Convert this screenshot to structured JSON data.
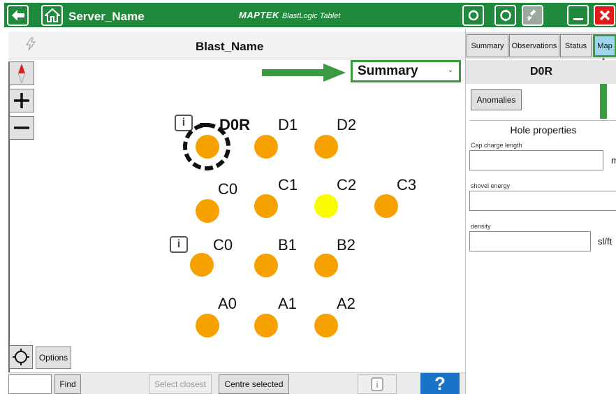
{
  "titlebar": {
    "server_name": "Server_Name",
    "brand_main": "MAPTEK",
    "brand_sub": "BlastLogic Tablet"
  },
  "header": {
    "blast_name": "Blast_Name"
  },
  "summary_dropdown": {
    "selected": "Summary"
  },
  "holes": [
    {
      "label": "D0R",
      "highlight": false,
      "selected": true
    },
    {
      "label": "D1",
      "highlight": false
    },
    {
      "label": "D2",
      "highlight": false
    },
    {
      "label": "C0",
      "highlight": false
    },
    {
      "label": "C1",
      "highlight": false
    },
    {
      "label": "C2",
      "highlight": true
    },
    {
      "label": "C3",
      "highlight": false
    },
    {
      "label": "C0",
      "highlight": false
    },
    {
      "label": "B1",
      "highlight": false
    },
    {
      "label": "B2",
      "highlight": false
    },
    {
      "label": "A0",
      "highlight": false
    },
    {
      "label": "A1",
      "highlight": false
    },
    {
      "label": "A2",
      "highlight": false
    }
  ],
  "bottom_bar": {
    "find_label": "Find",
    "select_closest_label": "Select closest",
    "centre_selected_label": "Centre selected",
    "help_label": "?",
    "options_label": "Options"
  },
  "right_panel": {
    "tabs": [
      "Summary",
      "Observations",
      "Status",
      "Map"
    ],
    "active_tab": "Map",
    "hole_title": "D0R",
    "anomalies_label": "Anomalies",
    "section_title": "Hole properties",
    "fields": [
      {
        "label": "Cap charge length",
        "unit": "m"
      },
      {
        "label": "shovel energy",
        "unit": ""
      },
      {
        "label": "density",
        "unit": "sl/ft"
      }
    ]
  },
  "colors": {
    "brand_green": "#1f8a3b",
    "hole_orange": "#f7a100",
    "hole_yellow": "#fbfb00",
    "accent_green": "#3a9a3f",
    "help_blue": "#1973c7",
    "active_tab": "#9fd6ec"
  },
  "icons": [
    "back-arrow-icon",
    "home-icon",
    "refresh-icon",
    "sync-icon",
    "satellite-icon",
    "minimize-icon",
    "close-icon",
    "compass-icon",
    "zoom-in-icon",
    "zoom-out-icon",
    "crosshair-icon",
    "info-icon",
    "lightning-icon"
  ]
}
